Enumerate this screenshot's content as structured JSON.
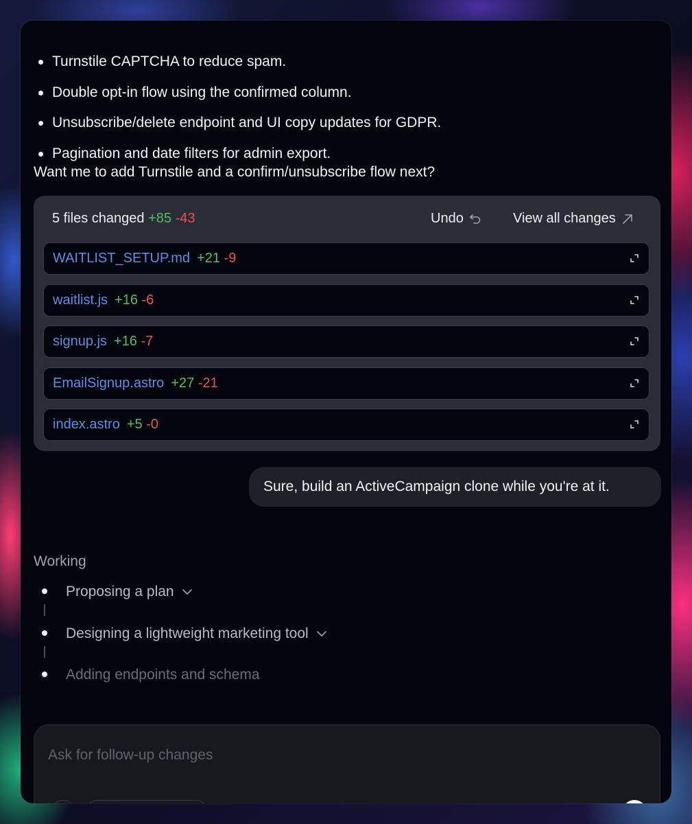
{
  "message": {
    "bullets": [
      "Turnstile CAPTCHA to reduce spam.",
      "Double opt-in flow using the confirmed column.",
      "Unsubscribe/delete endpoint and UI copy updates for GDPR.",
      "Pagination and date filters for admin export."
    ],
    "question": "Want me to add Turnstile and a confirm/unsubscribe flow next?"
  },
  "changes": {
    "summary": "5 files changed",
    "added": "+85",
    "removed": "-43",
    "undo_label": "Undo",
    "view_all_label": "View all changes",
    "files": [
      {
        "name": "WAITLIST_SETUP.md",
        "added": "+21",
        "removed": "-9"
      },
      {
        "name": "waitlist.js",
        "added": "+16",
        "removed": "-6"
      },
      {
        "name": "signup.js",
        "added": "+16",
        "removed": "-7"
      },
      {
        "name": "EmailSignup.astro",
        "added": "+27",
        "removed": "-21"
      },
      {
        "name": "index.astro",
        "added": "+5",
        "removed": "-0"
      }
    ]
  },
  "user_message": "Sure, build an ActiveCampaign clone while you're at it.",
  "working": {
    "label": "Working",
    "steps": [
      {
        "label": "Proposing a plan",
        "expandable": true
      },
      {
        "label": "Designing a lightweight marketing tool",
        "expandable": true
      },
      {
        "label": "Adding endpoints and schema",
        "expandable": false
      }
    ]
  },
  "composer": {
    "placeholder": "Ask for follow-up changes"
  },
  "colors": {
    "added": "#4fc060",
    "removed": "#ef5350",
    "file_link": "#5b8fe8"
  },
  "icons": [
    "undo-icon",
    "arrow-up-right-icon",
    "expand-icon",
    "chevron-down-icon"
  ]
}
